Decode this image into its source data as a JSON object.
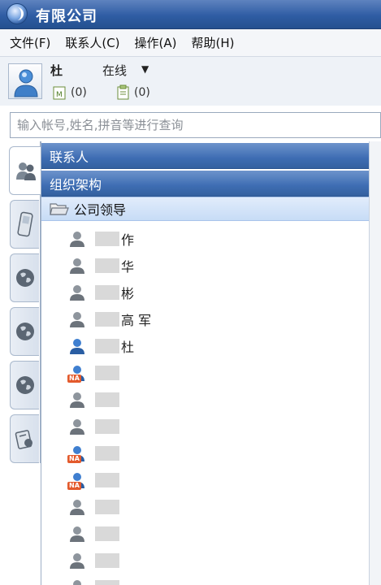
{
  "window": {
    "title": "有限公司"
  },
  "menu": [
    {
      "label": "文件(F)"
    },
    {
      "label": "联系人(C)"
    },
    {
      "label": "操作(A)"
    },
    {
      "label": "帮助(H)"
    }
  ],
  "user": {
    "name": "杜",
    "status": "在线",
    "mail_count": "(0)",
    "notes_count": "(0)"
  },
  "search": {
    "placeholder": "输入帐号,姓名,拼音等进行查询"
  },
  "sections": {
    "contacts": "联系人",
    "org": "组织架构"
  },
  "group": {
    "name": "公司领导"
  },
  "contacts": [
    {
      "name": "作",
      "icon": "user-gray-icon"
    },
    {
      "name": "华",
      "icon": "user-gray-icon"
    },
    {
      "name": "彬",
      "icon": "user-gray-icon"
    },
    {
      "name": "高 军",
      "icon": "user-gray-icon"
    },
    {
      "name": "杜",
      "icon": "user-blue-icon"
    },
    {
      "name": "",
      "icon": "user-na-icon"
    },
    {
      "name": "",
      "icon": "user-gray-icon"
    },
    {
      "name": "",
      "icon": "user-gray-icon"
    },
    {
      "name": "",
      "icon": "user-na-icon"
    },
    {
      "name": "",
      "icon": "user-na-icon"
    },
    {
      "name": "",
      "icon": "user-gray-icon"
    },
    {
      "name": "",
      "icon": "user-gray-icon"
    },
    {
      "name": "",
      "icon": "user-gray-icon"
    },
    {
      "name": "",
      "icon": "user-gray-icon"
    }
  ]
}
